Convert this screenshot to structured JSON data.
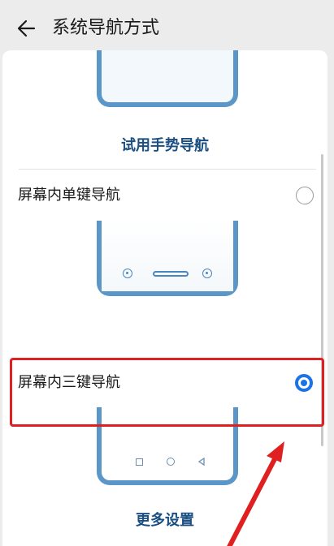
{
  "header": {
    "title": "系统导航方式"
  },
  "options": [
    {
      "label": "屏幕内单键导航",
      "selected": false
    },
    {
      "label": "屏幕内三键导航",
      "selected": true
    }
  ],
  "links": {
    "try_gesture": "试用手势导航",
    "more_settings": "更多设置"
  },
  "colors": {
    "accent": "#1a73e8",
    "link": "#1b4f82",
    "phone_frame": "#5b96c9",
    "highlight": "#e02020"
  },
  "icons": {
    "back": "back-arrow-icon",
    "annotation": "red-arrow-annotation"
  }
}
